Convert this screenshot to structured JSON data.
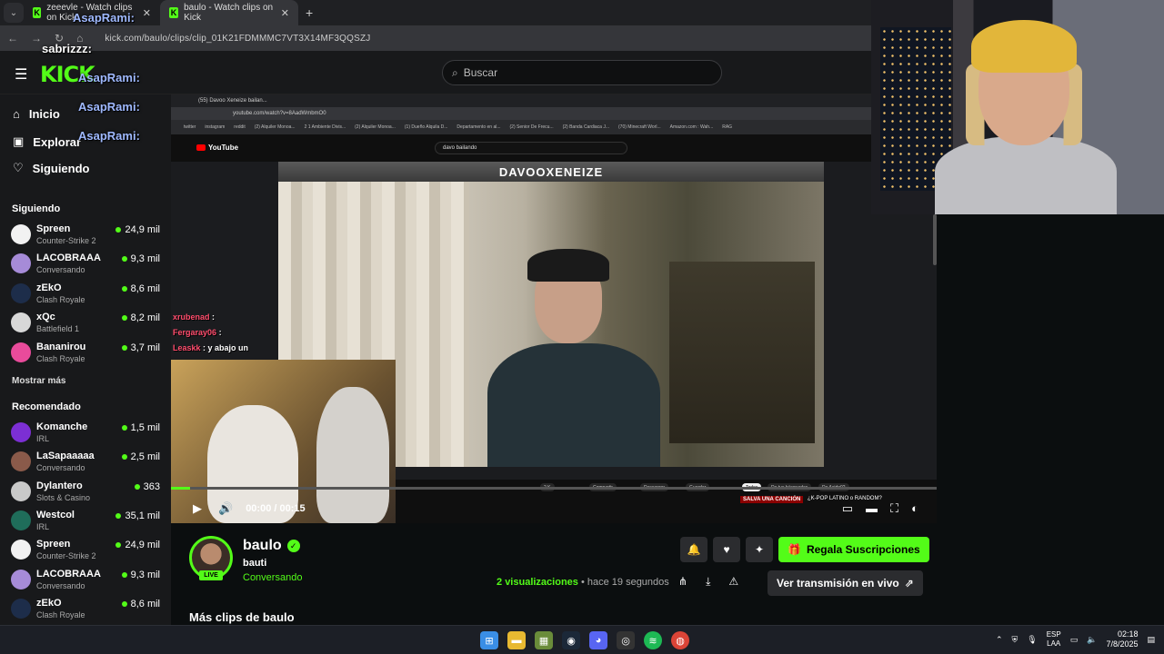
{
  "browser": {
    "tabs": [
      {
        "label": "zeeevle - Watch clips on Kick"
      },
      {
        "label": "baulo - Watch clips on Kick"
      }
    ],
    "url": "kick.com/baulo/clips/clip_01K21FDMMMC7VT3X14MF3QQSZJ"
  },
  "kick": {
    "logo": "KICK",
    "logo_beta": "BETA",
    "search_placeholder": "Buscar"
  },
  "nav": [
    {
      "label": "Inicio",
      "icon": "home-icon"
    },
    {
      "label": "Explorar",
      "icon": "compass-icon"
    },
    {
      "label": "Siguiendo",
      "icon": "heart-icon"
    }
  ],
  "following": {
    "header": "Siguiendo",
    "channels": [
      {
        "name": "Spreen",
        "category": "Counter-Strike 2",
        "viewers": "24,9 mil",
        "color": "#f2f2f2"
      },
      {
        "name": "LACOBRAAA",
        "category": "Conversando",
        "viewers": "9,3 mil",
        "color": "#a68bd8"
      },
      {
        "name": "zEkO",
        "category": "Clash Royale",
        "viewers": "8,6 mil",
        "color": "#1d2d4a"
      },
      {
        "name": "xQc",
        "category": "Battlefield 1",
        "viewers": "8,2 mil",
        "color": "#d8d8d8"
      },
      {
        "name": "Bananirou",
        "category": "Clash Royale",
        "viewers": "3,7 mil",
        "color": "#e94b9b"
      }
    ],
    "more_label": "Mostrar más"
  },
  "recommended": {
    "header": "Recomendado",
    "channels": [
      {
        "name": "Komanche",
        "category": "IRL",
        "viewers": "1,5 mil",
        "color": "#7c2fd4"
      },
      {
        "name": "LaSapaaaaa",
        "category": "Conversando",
        "viewers": "2,5 mil",
        "color": "#8a5a4a"
      },
      {
        "name": "Dylantero",
        "category": "Slots & Casino",
        "viewers": "363",
        "color": "#c9c9c9"
      },
      {
        "name": "Westcol",
        "category": "IRL",
        "viewers": "35,1 mil",
        "color": "#1f6d5a"
      },
      {
        "name": "Spreen",
        "category": "Counter-Strike 2",
        "viewers": "24,9 mil",
        "color": "#f2f2f2"
      },
      {
        "name": "LACOBRAAA",
        "category": "Conversando",
        "viewers": "9,3 mil",
        "color": "#a68bd8"
      },
      {
        "name": "zEkO",
        "category": "Clash Royale",
        "viewers": "8,6 mil",
        "color": "#1d2d4a"
      }
    ]
  },
  "overlay_chat": [
    {
      "user": "sabrizzz:"
    },
    {
      "user": "AsapRami:"
    },
    {
      "user": "AsapRami:"
    },
    {
      "user": "AsapRami:"
    },
    {
      "user": "AsapRami:"
    }
  ],
  "video_inner": {
    "yt_tab": "(55) Davoo Xeneize bailan...",
    "yt_url": "youtube.com/watch?v=8AadWmbmO0",
    "bookmarks": [
      "twitter",
      "instagram",
      "reddit",
      "(2) Alquiler Monoa...",
      "2 1 Ambiente Divis...",
      "(2) Alquiler Monoa...",
      "(1) Dueño Alquila D...",
      "Departamento en al...",
      "(2) Senior De Frecu...",
      "(2) Banda Cardiaca J...",
      "(70) Minecraft Worl...",
      "Amazon.com : Wah...",
      "RAG"
    ],
    "yt_logo": "YouTube",
    "yt_search": "davo bailando",
    "banner": "DAVOOXENEIZE",
    "chips": [
      "Todos",
      "De tus búsquedas",
      "De Acido02"
    ],
    "yt_buttons": [
      "2 K",
      "Compartir",
      "Descargar",
      "Guardar"
    ],
    "salva": "SALVA UNA CANCIÓN",
    "salva_sub": "¿K-POP LATINO o RANDOM?",
    "stream_chat": [
      {
        "user": "xrubenad",
        "text": ":",
        "color": "#ff4d6d"
      },
      {
        "user": "Fergaray06",
        "text": ":",
        "color": "#ff4d6d"
      },
      {
        "user": "Leaskk",
        "text": ": y abajo un",
        "color": "#ff4d6d"
      }
    ]
  },
  "player": {
    "progress": 0.025,
    "current": "00:00",
    "separator": "/",
    "duration": "00:15"
  },
  "channel": {
    "name": "baulo",
    "display": "bauti",
    "category": "Conversando",
    "live_label": "LIVE",
    "gift_label": "Regala Suscripciones",
    "views_num": "2",
    "views_label": "visualizaciones",
    "ago": "• hace 19 segundos",
    "live_button": "Ver transmisión en vivo",
    "more_clips": "Más clips de baulo"
  },
  "taskbar": {
    "lang": "ESP",
    "lang_sub": "LAA",
    "time": "02:18",
    "date": "7/8/2025"
  }
}
